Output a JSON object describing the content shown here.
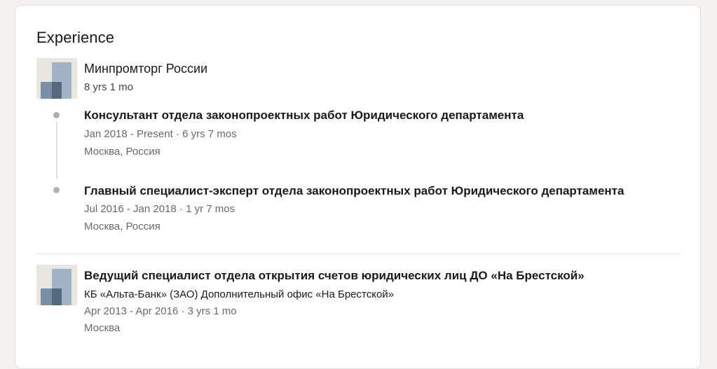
{
  "section": {
    "title": "Experience"
  },
  "company1": {
    "name": "Минпромторг России",
    "duration": "8 yrs 1 mo",
    "roles": [
      {
        "title": "Консультант отдела законопроектных работ Юридического департамента",
        "dates": "Jan 2018 - Present · 6 yrs 7 mos",
        "location": "Москва, Россия"
      },
      {
        "title": "Главный специалист-эксперт отдела законопроектных работ Юридического департамента",
        "dates": "Jul 2016 - Jan 2018 · 1 yr 7 mos",
        "location": "Москва, Россия"
      }
    ]
  },
  "position2": {
    "title": "Ведущий специалист отдела открытия счетов юридических лиц ДО «На Брестской»",
    "company": "КБ «Альта-Банк» (ЗАО) Дополнительный офис «На Брестской»",
    "dates": "Apr 2013 - Apr 2016 · 3 yrs 1 mo",
    "location": "Москва"
  }
}
